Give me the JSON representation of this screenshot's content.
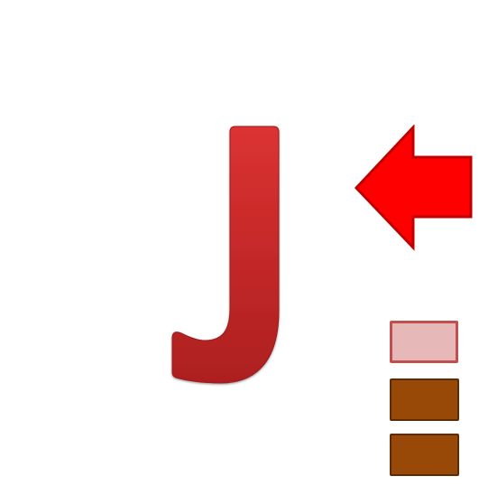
{
  "letter": {
    "char": "J",
    "color_top": "#dc3232",
    "color_bottom": "#ad1f1f"
  },
  "arrow": {
    "icon": "arrow-left-icon",
    "fill": "#ff0000",
    "stroke": "#c00000"
  },
  "swatches": [
    {
      "name": "pink",
      "color": "#e6b9b8",
      "border": "#c0504d"
    },
    {
      "name": "brown",
      "color": "#984807",
      "border": "#5c2c06"
    },
    {
      "name": "brown",
      "color": "#984807",
      "border": "#5c2c06"
    }
  ]
}
